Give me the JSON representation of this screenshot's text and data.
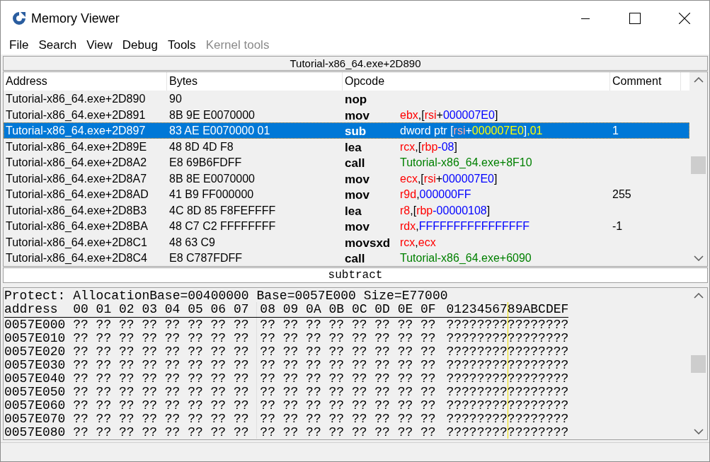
{
  "window": {
    "title": "Memory Viewer"
  },
  "menu": [
    {
      "label": "File",
      "disabled": false
    },
    {
      "label": "Search",
      "disabled": false
    },
    {
      "label": "View",
      "disabled": false
    },
    {
      "label": "Debug",
      "disabled": false
    },
    {
      "label": "Tools",
      "disabled": false
    },
    {
      "label": "Kernel tools",
      "disabled": true
    }
  ],
  "disassembler": {
    "location": "Tutorial-x86_64.exe+2D890",
    "columns": [
      "Address",
      "Bytes",
      "Opcode",
      "Comment"
    ],
    "rows": [
      {
        "address": "Tutorial-x86_64.exe+2D890",
        "bytes": "90",
        "mnemonic": "nop",
        "selected": false
      },
      {
        "address": "Tutorial-x86_64.exe+2D891",
        "bytes": "8B 9E E0070000",
        "mnemonic": "mov",
        "operand": [
          {
            "text": "ebx",
            "kind": "register"
          },
          {
            "text": ",[",
            "kind": "plain"
          },
          {
            "text": "rsi",
            "kind": "register"
          },
          {
            "text": "+",
            "kind": "plain"
          },
          {
            "text": "000007E0",
            "kind": "number"
          },
          {
            "text": "]",
            "kind": "plain"
          }
        ],
        "selected": false
      },
      {
        "address": "Tutorial-x86_64.exe+2D897",
        "bytes": "83 AE E0070000 01",
        "mnemonic": "sub",
        "operand": [
          {
            "text": "dword ptr [",
            "kind": "plain"
          },
          {
            "text": "rsi",
            "kind": "register"
          },
          {
            "text": "+",
            "kind": "plain"
          },
          {
            "text": "000007E0",
            "kind": "number"
          },
          {
            "text": "]",
            "kind": "plain"
          },
          {
            "text": ",01",
            "kind": "number"
          }
        ],
        "comment": "1",
        "selected": true
      },
      {
        "address": "Tutorial-x86_64.exe+2D89E",
        "bytes": "48 8D 4D F8",
        "mnemonic": "lea",
        "operand": [
          {
            "text": "rcx",
            "kind": "register"
          },
          {
            "text": ",[",
            "kind": "plain"
          },
          {
            "text": "rbp",
            "kind": "register"
          },
          {
            "text": "-08",
            "kind": "number"
          },
          {
            "text": "]",
            "kind": "plain"
          }
        ],
        "selected": false
      },
      {
        "address": "Tutorial-x86_64.exe+2D8A2",
        "bytes": "E8 69B6FDFF",
        "mnemonic": "call",
        "operand": [
          {
            "text": "Tutorial-x86_64.exe+8F10",
            "kind": "symbol"
          }
        ],
        "selected": false
      },
      {
        "address": "Tutorial-x86_64.exe+2D8A7",
        "bytes": "8B 8E E0070000",
        "mnemonic": "mov",
        "operand": [
          {
            "text": "ecx",
            "kind": "register"
          },
          {
            "text": ",[",
            "kind": "plain"
          },
          {
            "text": "rsi",
            "kind": "register"
          },
          {
            "text": "+",
            "kind": "plain"
          },
          {
            "text": "000007E0",
            "kind": "number"
          },
          {
            "text": "]",
            "kind": "plain"
          }
        ],
        "selected": false
      },
      {
        "address": "Tutorial-x86_64.exe+2D8AD",
        "bytes": "41 B9 FF000000",
        "mnemonic": "mov",
        "operand": [
          {
            "text": "r9d",
            "kind": "register"
          },
          {
            "text": ",",
            "kind": "plain"
          },
          {
            "text": "000000FF",
            "kind": "number"
          }
        ],
        "comment": "255",
        "selected": false
      },
      {
        "address": "Tutorial-x86_64.exe+2D8B3",
        "bytes": "4C 8D 85 F8FEFFFF",
        "mnemonic": "lea",
        "operand": [
          {
            "text": "r8",
            "kind": "register"
          },
          {
            "text": ",[",
            "kind": "plain"
          },
          {
            "text": "rbp",
            "kind": "register"
          },
          {
            "text": "-00000108",
            "kind": "number"
          },
          {
            "text": "]",
            "kind": "plain"
          }
        ],
        "selected": false
      },
      {
        "address": "Tutorial-x86_64.exe+2D8BA",
        "bytes": "48 C7 C2 FFFFFFFF",
        "mnemonic": "mov",
        "operand": [
          {
            "text": "rdx",
            "kind": "register"
          },
          {
            "text": ",",
            "kind": "plain"
          },
          {
            "text": "FFFFFFFFFFFFFFFF",
            "kind": "number"
          }
        ],
        "comment": "-1",
        "selected": false
      },
      {
        "address": "Tutorial-x86_64.exe+2D8C1",
        "bytes": "48 63 C9",
        "mnemonic": "movsxd",
        "operand": [
          {
            "text": "rcx",
            "kind": "register"
          },
          {
            "text": ",",
            "kind": "plain"
          },
          {
            "text": "ecx",
            "kind": "register"
          }
        ],
        "selected": false
      },
      {
        "address": "Tutorial-x86_64.exe+2D8C4",
        "bytes": "E8 C787FDFF",
        "mnemonic": "call",
        "operand": [
          {
            "text": "Tutorial-x86_64.exe+6090",
            "kind": "symbol"
          }
        ],
        "selected": false
      }
    ],
    "description": "subtract"
  },
  "hex_view": {
    "info": "Protect: AllocationBase=00400000 Base=0057E000 Size=E77000",
    "header": {
      "label": "address",
      "columns": [
        "00",
        "01",
        "02",
        "03",
        "04",
        "05",
        "06",
        "07",
        "08",
        "09",
        "0A",
        "0B",
        "0C",
        "0D",
        "0E",
        "0F"
      ],
      "ascii": "0123456789ABCDEF"
    },
    "rows": [
      {
        "address": "0057E000",
        "bytes": [
          "??",
          "??",
          "??",
          "??",
          "??",
          "??",
          "??",
          "??",
          "??",
          "??",
          "??",
          "??",
          "??",
          "??",
          "??",
          "??"
        ],
        "ascii": "????????????????"
      },
      {
        "address": "0057E010",
        "bytes": [
          "??",
          "??",
          "??",
          "??",
          "??",
          "??",
          "??",
          "??",
          "??",
          "??",
          "??",
          "??",
          "??",
          "??",
          "??",
          "??"
        ],
        "ascii": "????????????????"
      },
      {
        "address": "0057E020",
        "bytes": [
          "??",
          "??",
          "??",
          "??",
          "??",
          "??",
          "??",
          "??",
          "??",
          "??",
          "??",
          "??",
          "??",
          "??",
          "??",
          "??"
        ],
        "ascii": "????????????????"
      },
      {
        "address": "0057E030",
        "bytes": [
          "??",
          "??",
          "??",
          "??",
          "??",
          "??",
          "??",
          "??",
          "??",
          "??",
          "??",
          "??",
          "??",
          "??",
          "??",
          "??"
        ],
        "ascii": "????????????????"
      },
      {
        "address": "0057E040",
        "bytes": [
          "??",
          "??",
          "??",
          "??",
          "??",
          "??",
          "??",
          "??",
          "??",
          "??",
          "??",
          "??",
          "??",
          "??",
          "??",
          "??"
        ],
        "ascii": "????????????????"
      },
      {
        "address": "0057E050",
        "bytes": [
          "??",
          "??",
          "??",
          "??",
          "??",
          "??",
          "??",
          "??",
          "??",
          "??",
          "??",
          "??",
          "??",
          "??",
          "??",
          "??"
        ],
        "ascii": "????????????????"
      },
      {
        "address": "0057E060",
        "bytes": [
          "??",
          "??",
          "??",
          "??",
          "??",
          "??",
          "??",
          "??",
          "??",
          "??",
          "??",
          "??",
          "??",
          "??",
          "??",
          "??"
        ],
        "ascii": "????????????????"
      },
      {
        "address": "0057E070",
        "bytes": [
          "??",
          "??",
          "??",
          "??",
          "??",
          "??",
          "??",
          "??",
          "??",
          "??",
          "??",
          "??",
          "??",
          "??",
          "??",
          "??"
        ],
        "ascii": "????????????????"
      },
      {
        "address": "0057E080",
        "bytes": [
          "??",
          "??",
          "??",
          "??",
          "??",
          "??",
          "??",
          "??",
          "??",
          "??",
          "??",
          "??",
          "??",
          "??",
          "??",
          "??"
        ],
        "ascii": "????????????????"
      }
    ]
  }
}
